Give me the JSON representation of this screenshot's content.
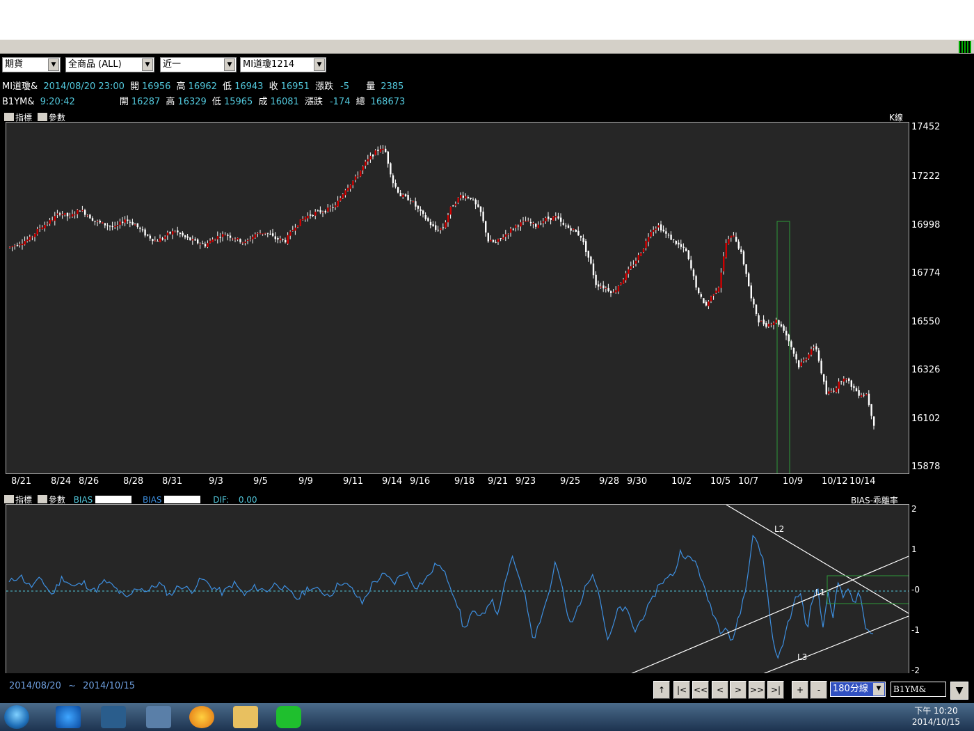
{
  "toolbar": {
    "market": "期貨",
    "products": "全商品 (ALL)",
    "period": "近一",
    "symbol": "MI道瓊1214"
  },
  "quote1": {
    "name": "MI道瓊&",
    "datetime": "2014/08/20 23:00",
    "open_l": "開",
    "open": "16956",
    "high_l": "高",
    "high": "16962",
    "low_l": "低",
    "low": "16943",
    "close_l": "收",
    "close": "16951",
    "chg_l": "漲跌",
    "chg": "-5",
    "vol_l": "量",
    "vol": "2385"
  },
  "quote2": {
    "name": "B1YM&",
    "time": "9:20:42",
    "open_l": "開",
    "open": "16287",
    "high_l": "高",
    "high": "16329",
    "low_l": "低",
    "low": "15965",
    "close_l": "成",
    "close": "16081",
    "chg_l": "漲跌",
    "chg": "-174",
    "vol_l": "總",
    "vol": "168673"
  },
  "main_panel": {
    "ind_label": "指標",
    "param_label": "參數",
    "chart_name": "K線"
  },
  "sub_panel": {
    "ind_label": "指標",
    "param_label": "參數",
    "bias1": "BIAS",
    "bias2": "BIAS",
    "dif": "DIF:",
    "dif_val": "0.00",
    "chart_name": "BIAS-乖離率"
  },
  "bottom": {
    "date_from": "2014/08/20",
    "tilde": "~",
    "date_to": "2014/10/15",
    "interval": "180分線",
    "symbol": "B1YM&",
    "nav": [
      "↑",
      "|<",
      "<<",
      "<",
      ">",
      ">>",
      ">|",
      "+",
      "-"
    ]
  },
  "clock": {
    "time": "下午 10:20",
    "date": "2014/10/15"
  },
  "colors": {
    "up": "#d00000",
    "down": "#ffffff",
    "bias": "#3d8fe0",
    "box": "#2e9a3a",
    "bg": "#262626"
  },
  "chart_data": [
    {
      "type": "candlestick",
      "title": "K線",
      "ylim": [
        15878,
        17452
      ],
      "y_ticks": [
        17452,
        17222,
        16998,
        16774,
        16550,
        16326,
        16102,
        15878
      ],
      "x_ticks": [
        "8/21",
        "8/24",
        "8/26",
        "8/28",
        "8/31",
        "9/3",
        "9/5",
        "9/9",
        "9/11",
        "9/14",
        "9/16",
        "9/18",
        "9/21",
        "9/23",
        "9/25",
        "9/28",
        "9/30",
        "10/2",
        "10/5",
        "10/7",
        "10/9",
        "10/12",
        "10/14"
      ],
      "path": [
        [
          0,
          16900
        ],
        [
          8,
          16940
        ],
        [
          12,
          16990
        ],
        [
          16,
          17020
        ],
        [
          20,
          17060
        ],
        [
          24,
          17040
        ],
        [
          28,
          17075
        ],
        [
          31,
          17050
        ],
        [
          34,
          17020
        ],
        [
          38,
          17005
        ],
        [
          42,
          16990
        ],
        [
          46,
          17030
        ],
        [
          50,
          17005
        ],
        [
          54,
          16960
        ],
        [
          58,
          16930
        ],
        [
          61,
          16940
        ],
        [
          63,
          16960
        ],
        [
          66,
          16975
        ],
        [
          70,
          16945
        ],
        [
          74,
          16925
        ],
        [
          78,
          16910
        ],
        [
          82,
          16945
        ],
        [
          86,
          16960
        ],
        [
          90,
          16940
        ],
        [
          94,
          16920
        ],
        [
          98,
          16960
        ],
        [
          102,
          16970
        ],
        [
          106,
          16940
        ],
        [
          110,
          16930
        ],
        [
          114,
          17000
        ],
        [
          118,
          17040
        ],
        [
          122,
          17060
        ],
        [
          126,
          17070
        ],
        [
          130,
          17090
        ],
        [
          134,
          17170
        ],
        [
          138,
          17220
        ],
        [
          142,
          17290
        ],
        [
          145,
          17330
        ],
        [
          148,
          17360
        ],
        [
          150,
          17340
        ],
        [
          153,
          17200
        ],
        [
          156,
          17140
        ],
        [
          160,
          17120
        ],
        [
          164,
          17060
        ],
        [
          167,
          17020
        ],
        [
          170,
          16980
        ],
        [
          173,
          16990
        ],
        [
          176,
          17080
        ],
        [
          180,
          17140
        ],
        [
          184,
          17130
        ],
        [
          188,
          17060
        ],
        [
          191,
          16930
        ],
        [
          194,
          16920
        ],
        [
          198,
          16960
        ],
        [
          202,
          17000
        ],
        [
          206,
          17020
        ],
        [
          210,
          17000
        ],
        [
          214,
          17030
        ],
        [
          218,
          17040
        ],
        [
          221,
          17000
        ],
        [
          225,
          16980
        ],
        [
          228,
          16950
        ],
        [
          232,
          16820
        ],
        [
          234,
          16730
        ],
        [
          238,
          16710
        ],
        [
          241,
          16690
        ],
        [
          244,
          16740
        ],
        [
          247,
          16790
        ],
        [
          250,
          16840
        ],
        [
          253,
          16900
        ],
        [
          256,
          16980
        ],
        [
          259,
          17000
        ],
        [
          262,
          16960
        ],
        [
          266,
          16920
        ],
        [
          270,
          16880
        ],
        [
          273,
          16760
        ],
        [
          275,
          16680
        ],
        [
          278,
          16630
        ],
        [
          281,
          16690
        ],
        [
          283,
          16720
        ],
        [
          286,
          16920
        ],
        [
          289,
          16960
        ],
        [
          292,
          16870
        ],
        [
          294,
          16780
        ],
        [
          296,
          16660
        ],
        [
          299,
          16560
        ],
        [
          302,
          16540
        ],
        [
          306,
          16560
        ],
        [
          309,
          16520
        ],
        [
          312,
          16440
        ],
        [
          315,
          16350
        ],
        [
          318,
          16390
        ],
        [
          320,
          16430
        ],
        [
          322,
          16430
        ],
        [
          324,
          16320
        ],
        [
          326,
          16220
        ],
        [
          329,
          16240
        ],
        [
          333,
          16300
        ],
        [
          336,
          16260
        ],
        [
          339,
          16220
        ],
        [
          342,
          16220
        ],
        [
          345,
          16080
        ]
      ]
    },
    {
      "type": "line",
      "title": "BIAS-乖離率",
      "ylim": [
        -2,
        2
      ],
      "y_ticks": [
        2,
        1,
        0,
        -1,
        -2
      ],
      "path": [
        [
          0,
          0.2
        ],
        [
          4,
          0.4
        ],
        [
          8,
          0.1
        ],
        [
          12,
          0.3
        ],
        [
          16,
          -0.1
        ],
        [
          20,
          0.35
        ],
        [
          24,
          0.1
        ],
        [
          28,
          0.2
        ],
        [
          32,
          0.0
        ],
        [
          36,
          0.25
        ],
        [
          40,
          0.05
        ],
        [
          44,
          -0.2
        ],
        [
          48,
          0.1
        ],
        [
          52,
          0.0
        ],
        [
          56,
          0.2
        ],
        [
          60,
          -0.1
        ],
        [
          64,
          0.15
        ],
        [
          68,
          0.0
        ],
        [
          72,
          0.3
        ],
        [
          76,
          0.1
        ],
        [
          80,
          -0.05
        ],
        [
          84,
          0.2
        ],
        [
          88,
          -0.1
        ],
        [
          92,
          0.1
        ],
        [
          96,
          0.0
        ],
        [
          100,
          0.2
        ],
        [
          104,
          0.0
        ],
        [
          108,
          -0.2
        ],
        [
          112,
          0.1
        ],
        [
          116,
          0.0
        ],
        [
          120,
          -0.1
        ],
        [
          124,
          0.25
        ],
        [
          128,
          0.05
        ],
        [
          132,
          -0.3
        ],
        [
          136,
          0.2
        ],
        [
          140,
          0.4
        ],
        [
          144,
          0.2
        ],
        [
          148,
          0.5
        ],
        [
          152,
          0.1
        ],
        [
          156,
          0.3
        ],
        [
          160,
          0.7
        ],
        [
          164,
          0.3
        ],
        [
          168,
          -0.4
        ],
        [
          170,
          -1.0
        ],
        [
          173,
          -0.5
        ],
        [
          176,
          -0.7
        ],
        [
          180,
          -0.2
        ],
        [
          183,
          -0.6
        ],
        [
          186,
          0.4
        ],
        [
          188,
          0.8
        ],
        [
          190,
          0.5
        ],
        [
          192,
          0.1
        ],
        [
          194,
          -0.5
        ],
        [
          196,
          -1.2
        ],
        [
          199,
          -0.6
        ],
        [
          202,
          0.0
        ],
        [
          204,
          0.7
        ],
        [
          206,
          0.3
        ],
        [
          208,
          -0.4
        ],
        [
          210,
          -0.9
        ],
        [
          212,
          -0.5
        ],
        [
          215,
          0.0
        ],
        [
          218,
          0.5
        ],
        [
          220,
          0.1
        ],
        [
          222,
          -0.6
        ],
        [
          224,
          -1.3
        ],
        [
          226,
          -0.8
        ],
        [
          228,
          -0.4
        ],
        [
          231,
          -0.5
        ],
        [
          234,
          -1.0
        ],
        [
          237,
          -0.6
        ],
        [
          240,
          -0.3
        ],
        [
          243,
          0.2
        ],
        [
          246,
          0.3
        ],
        [
          249,
          0.5
        ],
        [
          251,
          1.0
        ],
        [
          254,
          0.8
        ],
        [
          257,
          0.7
        ],
        [
          260,
          0.0
        ],
        [
          263,
          -0.5
        ],
        [
          266,
          -1.0
        ],
        [
          268,
          -0.8
        ],
        [
          270,
          -1.3
        ],
        [
          273,
          -0.6
        ],
        [
          276,
          0.3
        ],
        [
          278,
          1.4
        ],
        [
          280,
          1.2
        ],
        [
          282,
          0.7
        ],
        [
          284,
          -0.4
        ],
        [
          286,
          -1.5
        ],
        [
          288,
          -1.6
        ],
        [
          290,
          -1.1
        ],
        [
          292,
          -0.6
        ],
        [
          294,
          -0.2
        ],
        [
          296,
          0.0
        ],
        [
          298,
          -1.0
        ],
        [
          300,
          -0.3
        ],
        [
          302,
          0.2
        ],
        [
          304,
          -1.0
        ],
        [
          306,
          0.0
        ],
        [
          308,
          -0.6
        ],
        [
          310,
          0.3
        ],
        [
          312,
          -0.2
        ],
        [
          314,
          0.1
        ],
        [
          316,
          -0.3
        ],
        [
          318,
          0.0
        ],
        [
          320,
          -1.0
        ],
        [
          323,
          -1.1
        ]
      ],
      "annotations": [
        "L1",
        "L2",
        "L3"
      ]
    }
  ]
}
